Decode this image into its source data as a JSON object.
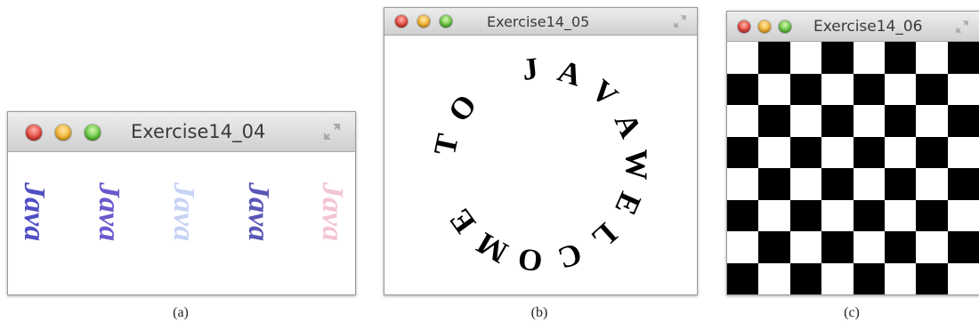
{
  "windows": {
    "a": {
      "title": "Exercise14_04",
      "words": [
        {
          "text": "Java",
          "color": "#4f4fc4"
        },
        {
          "text": "Java",
          "color": "#6a5acd"
        },
        {
          "text": "Java",
          "color": "#c7d3f5"
        },
        {
          "text": "Java",
          "color": "#5a57b8"
        },
        {
          "text": "Java",
          "color": "#f3c4d6"
        }
      ]
    },
    "b": {
      "title": "Exercise14_05",
      "message": "WELCOME TO JAVA"
    },
    "c": {
      "title": "Exercise14_06",
      "board": {
        "rows": 8,
        "cols": 8,
        "first_square": "white",
        "dark_color": "#000000",
        "light_color": "#ffffff"
      }
    }
  },
  "captions": [
    "(a)",
    "(b)",
    "(c)"
  ]
}
